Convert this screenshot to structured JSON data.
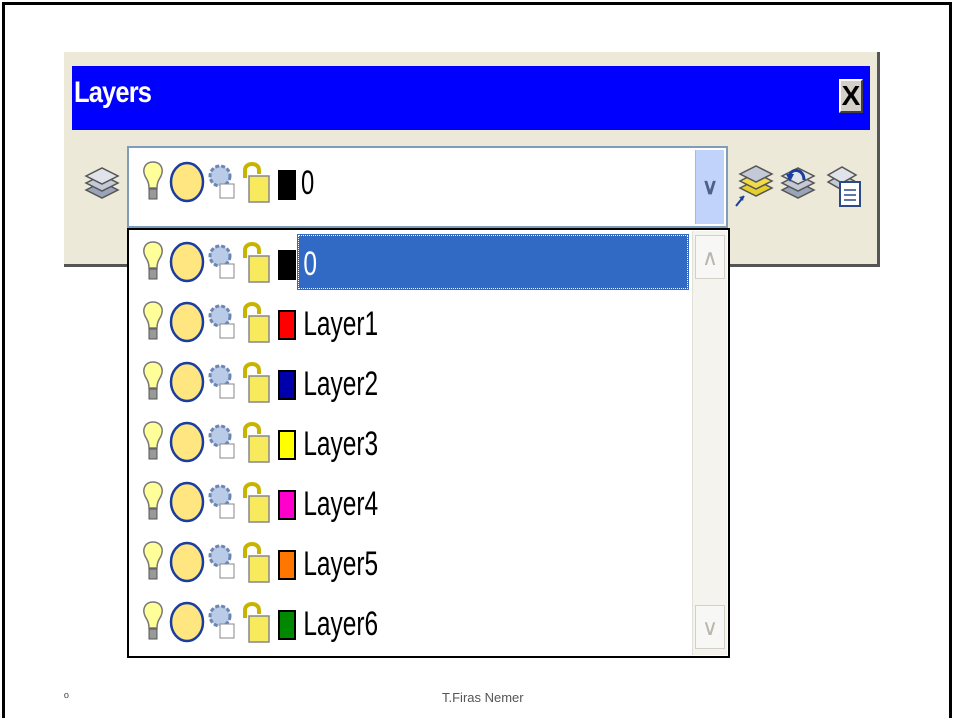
{
  "window": {
    "title": "Layers",
    "close_label": "X"
  },
  "combo": {
    "current_layer": "0",
    "arrow": "∨"
  },
  "layers": [
    {
      "name": "0",
      "color": "#000000",
      "selected": true
    },
    {
      "name": "Layer1",
      "color": "#ff0000",
      "selected": false
    },
    {
      "name": "Layer2",
      "color": "#0000aa",
      "selected": false
    },
    {
      "name": "Layer3",
      "color": "#ffff00",
      "selected": false
    },
    {
      "name": "Layer4",
      "color": "#ff00cc",
      "selected": false
    },
    {
      "name": "Layer5",
      "color": "#ff7700",
      "selected": false
    },
    {
      "name": "Layer6",
      "color": "#008800",
      "selected": false
    }
  ],
  "scroll": {
    "up": "∧",
    "down": "∨"
  },
  "toolbar_icons": [
    "layer-properties-icon",
    "make-object-layer-current-icon",
    "layer-previous-icon",
    "layer-states-icon"
  ],
  "footer": {
    "slide_number": "º",
    "author": "T.Firas Nemer"
  }
}
